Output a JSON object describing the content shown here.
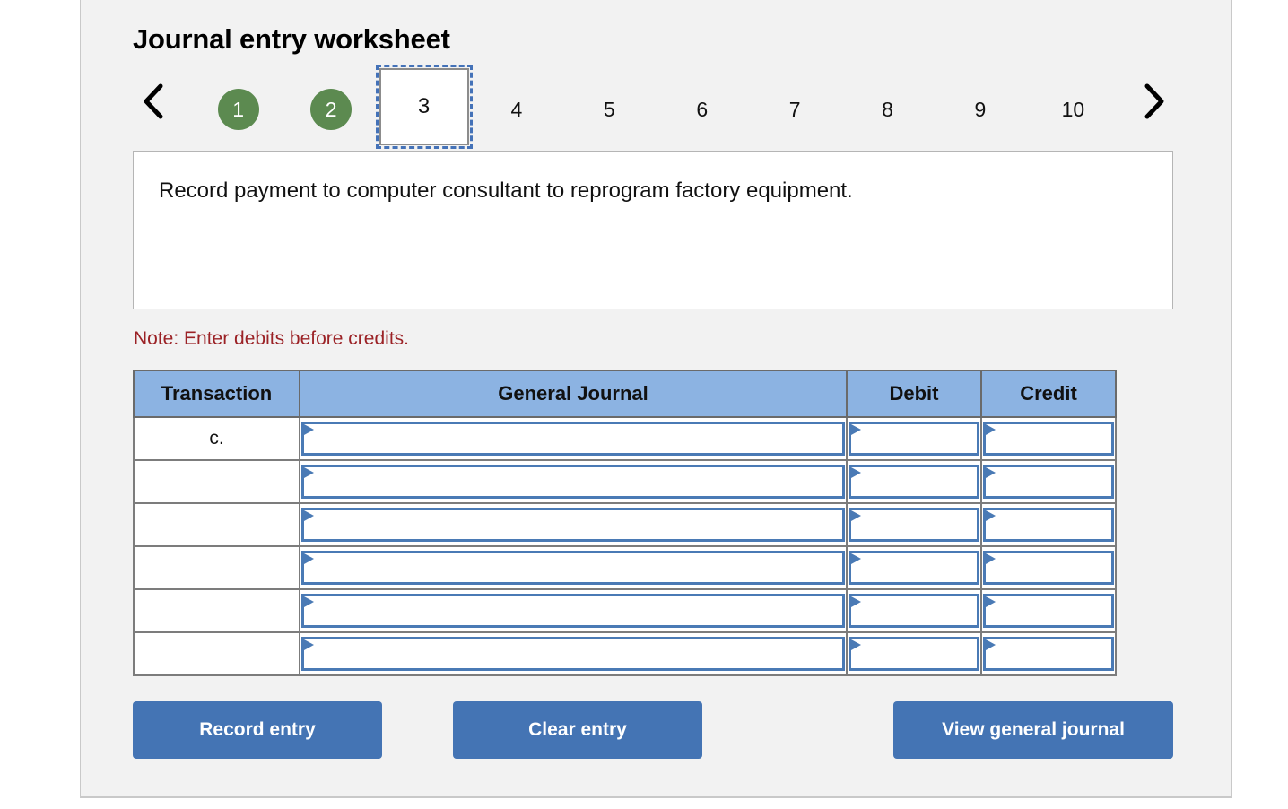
{
  "header": {
    "title": "Journal entry worksheet"
  },
  "nav": {
    "prev_icon": "chevron-left-icon",
    "next_icon": "chevron-right-icon",
    "steps": [
      {
        "label": "1",
        "state": "done"
      },
      {
        "label": "2",
        "state": "done"
      },
      {
        "label": "3",
        "state": "active"
      },
      {
        "label": "4",
        "state": "pending"
      },
      {
        "label": "5",
        "state": "pending"
      },
      {
        "label": "6",
        "state": "pending"
      },
      {
        "label": "7",
        "state": "pending"
      },
      {
        "label": "8",
        "state": "pending"
      },
      {
        "label": "9",
        "state": "pending"
      },
      {
        "label": "10",
        "state": "pending"
      }
    ]
  },
  "description": {
    "text": "Record payment to computer consultant to reprogram factory equipment."
  },
  "note": {
    "text": "Note: Enter debits before credits."
  },
  "table": {
    "columns": [
      "Transaction",
      "General Journal",
      "Debit",
      "Credit"
    ],
    "rows": [
      {
        "transaction": "c.",
        "general_journal": "",
        "debit": "",
        "credit": ""
      },
      {
        "transaction": "",
        "general_journal": "",
        "debit": "",
        "credit": ""
      },
      {
        "transaction": "",
        "general_journal": "",
        "debit": "",
        "credit": ""
      },
      {
        "transaction": "",
        "general_journal": "",
        "debit": "",
        "credit": ""
      },
      {
        "transaction": "",
        "general_journal": "",
        "debit": "",
        "credit": ""
      },
      {
        "transaction": "",
        "general_journal": "",
        "debit": "",
        "credit": ""
      }
    ]
  },
  "buttons": {
    "record": "Record entry",
    "clear": "Clear entry",
    "view": "View general journal"
  },
  "colors": {
    "step_done": "#5c8a50",
    "step_active_border": "#4472b8",
    "table_header": "#8cb3e2",
    "input_border": "#4a7ab5",
    "button": "#4474b4",
    "note": "#9b2226",
    "panel": "#f2f2f2"
  }
}
